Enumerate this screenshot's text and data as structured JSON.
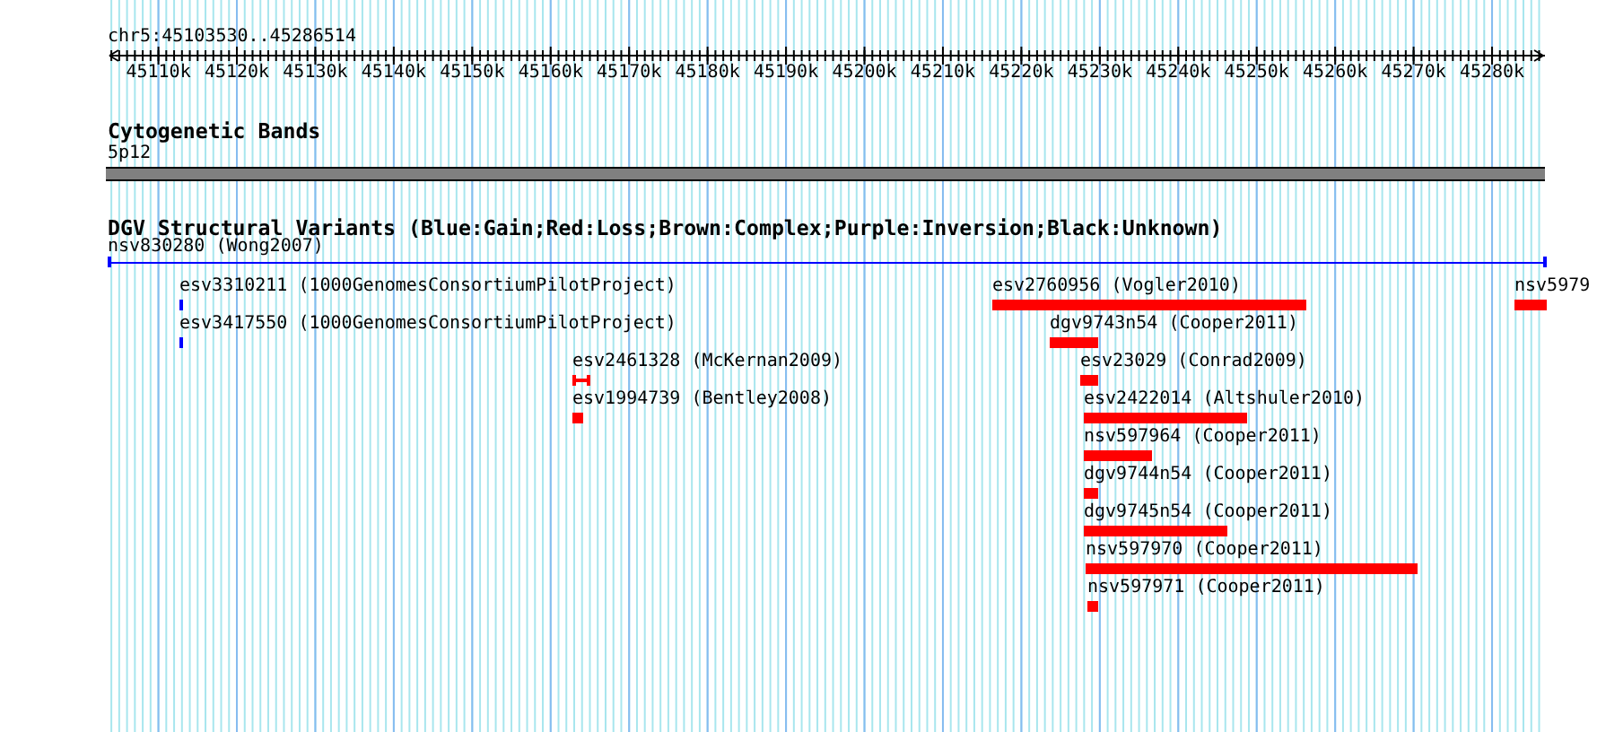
{
  "position": "chr5:45103530..45286514",
  "ruler": {
    "tick_labels": [
      "45110k",
      "45120k",
      "45130k",
      "45140k",
      "45150k",
      "45160k",
      "45170k",
      "45180k",
      "45190k",
      "45200k",
      "45210k",
      "45220k",
      "45230k",
      "45240k",
      "45250k",
      "45260k",
      "45270k",
      "45280k"
    ]
  },
  "cytogenetic_bands": {
    "title": "Cytogenetic Bands",
    "band_label": "5p12"
  },
  "dgv_track": {
    "title": "DGV Structural Variants (Blue:Gain;Red:Loss;Brown:Complex;Purple:Inversion;Black:Unknown)",
    "features": [
      {
        "label": "nsv830280 (Wong2007)",
        "color": "#0000ff",
        "kind": "line"
      },
      {
        "label": "esv3310211 (1000GenomesConsortiumPilotProject)",
        "color": "#0000ff",
        "kind": "bar"
      },
      {
        "label": "esv3417550 (1000GenomesConsortiumPilotProject)",
        "color": "#0000ff",
        "kind": "bar"
      },
      {
        "label": "esv2461328 (McKernan2009)",
        "color": "#ff0000",
        "kind": "interval"
      },
      {
        "label": "esv1994739 (Bentley2008)",
        "color": "#ff0000",
        "kind": "bar"
      },
      {
        "label": "esv2760956 (Vogler2010)",
        "color": "#ff0000",
        "kind": "bar"
      },
      {
        "label": "nsv5979",
        "color": "#ff0000",
        "kind": "bar"
      },
      {
        "label": "dgv9743n54 (Cooper2011)",
        "color": "#ff0000",
        "kind": "bar"
      },
      {
        "label": "esv23029 (Conrad2009)",
        "color": "#ff0000",
        "kind": "bar"
      },
      {
        "label": "esv2422014 (Altshuler2010)",
        "color": "#ff0000",
        "kind": "bar"
      },
      {
        "label": "nsv597964 (Cooper2011)",
        "color": "#ff0000",
        "kind": "bar"
      },
      {
        "label": "dgv9744n54 (Cooper2011)",
        "color": "#ff0000",
        "kind": "bar"
      },
      {
        "label": "dgv9745n54 (Cooper2011)",
        "color": "#ff0000",
        "kind": "bar"
      },
      {
        "label": "nsv597970 (Cooper2011)",
        "color": "#ff0000",
        "kind": "bar"
      },
      {
        "label": "nsv597971 (Cooper2011)",
        "color": "#ff0000",
        "kind": "bar"
      }
    ]
  }
}
